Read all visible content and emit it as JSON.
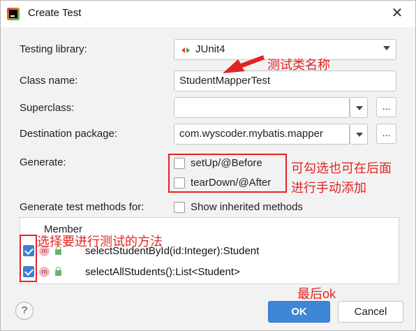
{
  "window": {
    "title": "Create Test",
    "close_glyph": "✕"
  },
  "form": {
    "testing_library_label": "Testing library:",
    "testing_library_value": "JUnit4",
    "class_name_label": "Class name:",
    "class_name_value": "StudentMapperTest",
    "superclass_label": "Superclass:",
    "superclass_value": "",
    "destination_label": "Destination package:",
    "destination_value": "com.wyscoder.mybatis.mapper",
    "browse_label": "...",
    "generate_label": "Generate:",
    "setup_label": "setUp/@Before",
    "setup_checked": false,
    "teardown_label": "tearDown/@After",
    "teardown_checked": false,
    "generate_methods_label": "Generate test methods for:",
    "show_inherited_label": "Show inherited methods",
    "show_inherited_checked": false
  },
  "table": {
    "header": "Member",
    "rows": [
      {
        "checked": true,
        "icon": "m",
        "method": "selectStudentById(id:Integer):Student"
      },
      {
        "checked": true,
        "icon": "m",
        "method": "selectAllStudents():List<Student>"
      }
    ]
  },
  "footer": {
    "help": "?",
    "ok": "OK",
    "cancel": "Cancel"
  },
  "annotations": {
    "class_name_note": "测试类名称",
    "generate_note_1": "可勾选也可在后面",
    "generate_note_2": "进行手动添加",
    "methods_note": "选择要进行测试的方法",
    "ok_note": "最后ok",
    "color": "#e02424"
  },
  "colors": {
    "primary_button": "#3d86d8",
    "checkbox_checked": "#3c7fd5",
    "dialog_bg": "#f2f2f2"
  }
}
